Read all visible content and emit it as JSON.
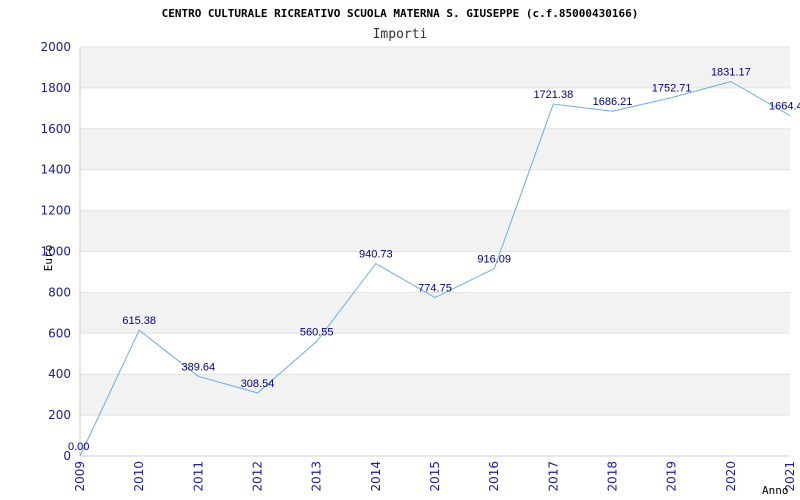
{
  "chart_data": {
    "type": "line",
    "title": "CENTRO CULTURALE RICREATIVO SCUOLA MATERNA S. GIUSEPPE (c.f.85000430166)",
    "subtitle": "Importi",
    "xlabel": "Anno",
    "ylabel": "Euro",
    "x": [
      "2009",
      "2010",
      "2011",
      "2012",
      "2013",
      "2014",
      "2015",
      "2016",
      "2017",
      "2018",
      "2019",
      "2020",
      "2021"
    ],
    "series": [
      {
        "values": [
          0.0,
          615.38,
          389.64,
          308.54,
          560.55,
          940.73,
          774.75,
          916.09,
          1721.38,
          1686.21,
          1752.71,
          1831.17,
          1664.4
        ],
        "labels": [
          "0.00",
          "615.38",
          "389.64",
          "308.54",
          "560.55",
          "940.73",
          "774.75",
          "916.09",
          "1721.38",
          "1686.21",
          "1752.71",
          "1831.17",
          "1664.4"
        ]
      }
    ],
    "ylim": [
      0,
      2000
    ],
    "yticks": [
      "0",
      "200",
      "400",
      "600",
      "800",
      "1000",
      "1200",
      "1400",
      "1600",
      "1800",
      "2000"
    ],
    "grid": "horizontal bands",
    "colors": {
      "line": "#6aaee6",
      "band": "#f2f2f2",
      "tick": "#1a1a9c",
      "label": "#000080"
    }
  }
}
